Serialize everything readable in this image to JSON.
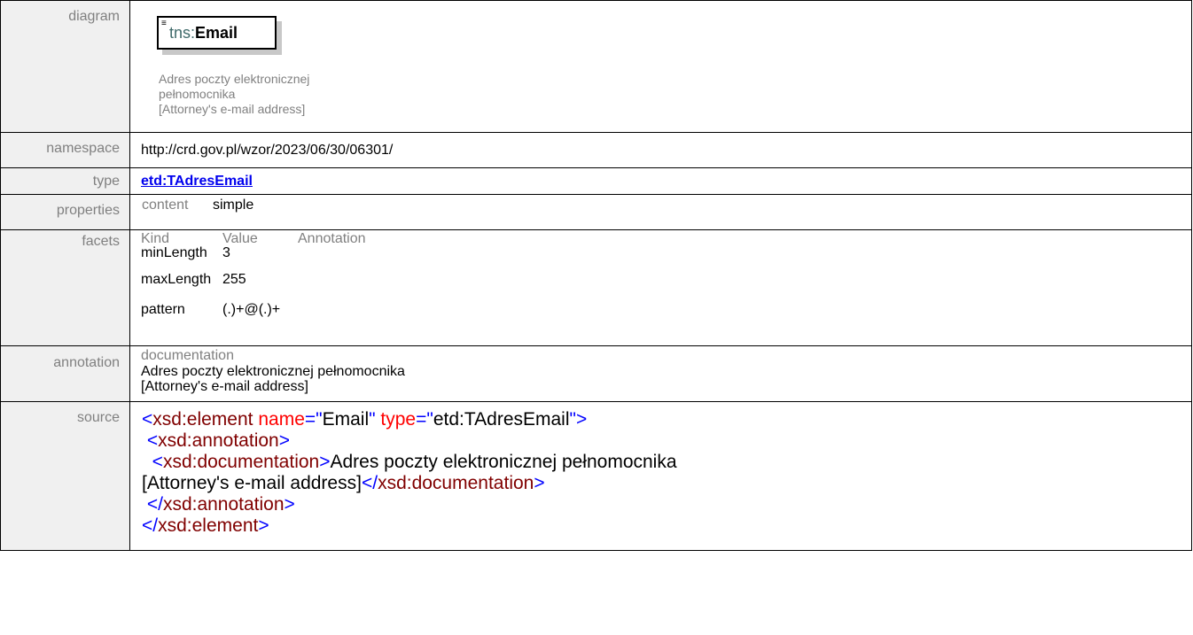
{
  "rows": {
    "diagram_label": "diagram",
    "namespace_label": "namespace",
    "type_label": "type",
    "properties_label": "properties",
    "facets_label": "facets",
    "annotation_label": "annotation",
    "source_label": "source"
  },
  "diagram": {
    "prefix": "tns:",
    "name": "Email",
    "doc": "Adres poczty elektronicznej\npełnomocnika\n[Attorney's e-mail address]",
    "icon": "element-icon"
  },
  "namespace": "http://crd.gov.pl/wzor/2023/06/30/06301/",
  "type": {
    "link_text": "etd:TAdresEmail"
  },
  "properties": {
    "key": "content",
    "value": "simple"
  },
  "facets": {
    "headers": [
      "Kind",
      "Value",
      "Annotation"
    ],
    "items": [
      {
        "kind": "minLength",
        "value": "3",
        "annotation": ""
      },
      {
        "kind": "maxLength",
        "value": "255",
        "annotation": ""
      },
      {
        "kind": "pattern",
        "value": "(.)+@(.)+",
        "annotation": ""
      }
    ]
  },
  "annotation": {
    "heading": "documentation",
    "text": "Adres poczty elektronicznej pełnomocnika\n[Attorney's e-mail address]"
  },
  "source": {
    "line1": {
      "lt": "<",
      "el": "xsd:element",
      "a1": "name",
      "eq1": "=\"",
      "v1": "Email",
      "q1": "\"",
      "a2": "type",
      "eq2": "=\"",
      "v2": "etd:TAdresEmail",
      "q2": "\"",
      "gt": ">"
    },
    "line2": {
      "lt": " <",
      "el": "xsd:annotation",
      "gt": ">"
    },
    "line3": {
      "lt": "  <",
      "el": "xsd:documentation",
      "gt": ">",
      "text": "Adres poczty elektronicznej pełnomocnika"
    },
    "line4": {
      "text": "[Attorney's e-mail address]",
      "lt": "</",
      "el": "xsd:documentation",
      "gt": ">"
    },
    "line5": {
      "lt": " </",
      "el": "xsd:annotation",
      "gt": ">"
    },
    "line6": {
      "lt": "</",
      "el": "xsd:element",
      "gt": ">"
    }
  },
  "colors": {
    "label_bg": "#f0f0f0",
    "label_text": "#808080",
    "xml_tag": "#0000ff",
    "xml_element": "#800000",
    "xml_attr": "#ff0000",
    "link": "#0000ee"
  }
}
